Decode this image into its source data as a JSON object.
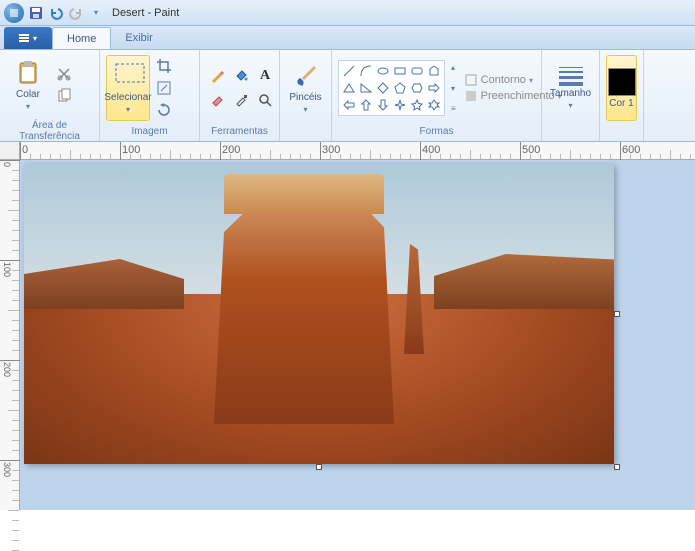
{
  "window": {
    "title": "Desert - Paint"
  },
  "tabs": {
    "home": "Home",
    "exibir": "Exibir"
  },
  "groups": {
    "clipboard": {
      "label": "Área de Transferência",
      "paste": "Colar"
    },
    "image": {
      "label": "Imagem",
      "select": "Selecionar"
    },
    "tools": {
      "label": "Ferramentas",
      "brushes": "Pincéis"
    },
    "shapes": {
      "label": "Formas",
      "outline": "Contorno",
      "fill": "Preenchimento"
    },
    "size": {
      "label": "Tamanho"
    },
    "color": {
      "label": "Cor 1"
    }
  },
  "ruler": {
    "marks": [
      0,
      100,
      200,
      300,
      400,
      500,
      600
    ],
    "vmarks": [
      0,
      100,
      200,
      300
    ]
  },
  "colors": {
    "current": "#000000"
  }
}
